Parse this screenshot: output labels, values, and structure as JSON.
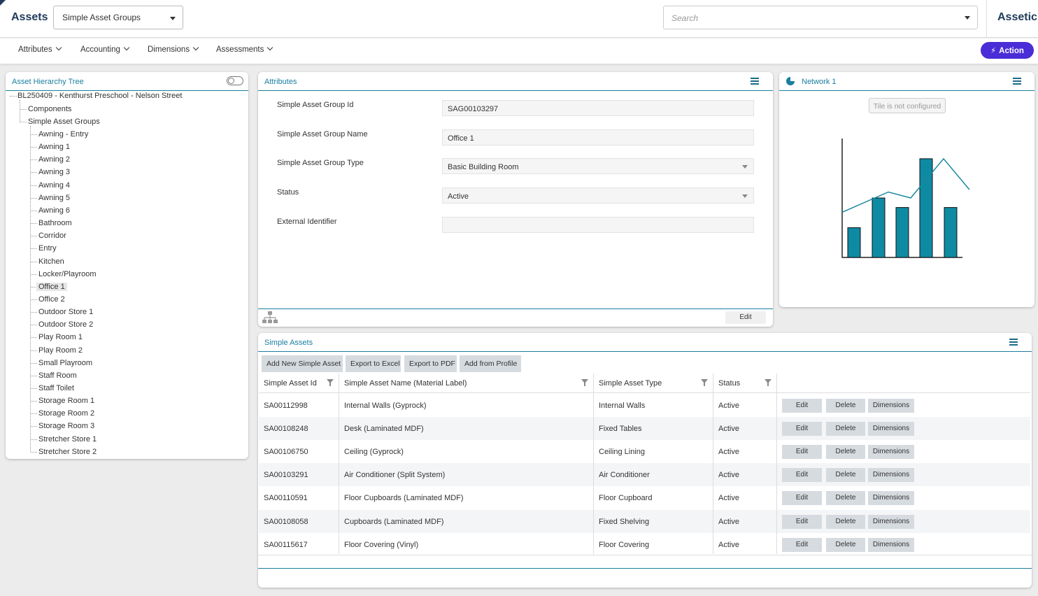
{
  "header": {
    "brand": "Assets",
    "group_select": "Simple Asset Groups",
    "search_placeholder": "Search",
    "logo": "Assetic"
  },
  "subnav": {
    "menus": [
      "Attributes",
      "Accounting",
      "Dimensions",
      "Assessments"
    ],
    "action_label": "Action"
  },
  "tree_panel": {
    "title": "Asset Hierarchy Tree",
    "root": "BL250409 - Kenthurst Preschool - Nelson Street",
    "components": "Components",
    "groups_label": "Simple Asset Groups",
    "selected": "Office 1",
    "items": [
      "Awning - Entry",
      "Awning 1",
      "Awning 2",
      "Awning 3",
      "Awning 4",
      "Awning 5",
      "Awning 6",
      "Bathroom",
      "Corridor",
      "Entry",
      "Kitchen",
      "Locker/Playroom",
      "Office 1",
      "Office 2",
      "Outdoor Store 1",
      "Outdoor Store 2",
      "Play Room 1",
      "Play Room 2",
      "Small Playroom",
      "Staff Room",
      "Staff Toilet",
      "Storage Room 1",
      "Storage Room 2",
      "Storage Room 3",
      "Stretcher Store 1",
      "Stretcher Store 2"
    ]
  },
  "attributes_panel": {
    "title": "Attributes",
    "fields": [
      {
        "label": "Simple Asset Group Id",
        "value": "SAG00103297"
      },
      {
        "label": "Simple Asset Group Name",
        "value": "Office 1"
      },
      {
        "label": "Simple Asset Group Type",
        "value": "Basic Building Room"
      },
      {
        "label": "Status",
        "value": "Active"
      },
      {
        "label": "External Identifier",
        "value": ""
      }
    ],
    "edit_label": "Edit"
  },
  "network_panel": {
    "title": "Network 1",
    "message": "Tile is not configured",
    "placeholder_chart": {
      "bars": [
        0.25,
        0.5,
        0.42,
        0.83,
        0.42
      ],
      "line": [
        0.38,
        0.55,
        0.5,
        0.83,
        0.57
      ],
      "bar_color": "#0f8aa3",
      "line_color": "#1a8aa0"
    }
  },
  "assets_panel": {
    "title": "Simple Assets",
    "toolbar": [
      "Add New Simple Asset",
      "Export to Excel",
      "Export to PDF",
      "Add from Profile"
    ],
    "columns": [
      "Simple Asset Id",
      "Simple Asset Name (Material Label)",
      "Simple Asset Type",
      "Status"
    ],
    "row_actions": [
      "Edit",
      "Delete",
      "Dimensions"
    ],
    "rows": [
      {
        "id": "SA00112998",
        "name": "Internal Walls (Gyprock)",
        "type": "Internal Walls",
        "status": "Active"
      },
      {
        "id": "SA00108248",
        "name": "Desk (Laminated MDF)",
        "type": "Fixed Tables",
        "status": "Active"
      },
      {
        "id": "SA00106750",
        "name": "Ceiling (Gyprock)",
        "type": "Ceiling Lining",
        "status": "Active"
      },
      {
        "id": "SA00103291",
        "name": "Air Conditioner (Split System)",
        "type": "Air Conditioner",
        "status": "Active"
      },
      {
        "id": "SA00110591",
        "name": "Floor Cupboards (Laminated MDF)",
        "type": "Floor Cupboard",
        "status": "Active"
      },
      {
        "id": "SA00108058",
        "name": "Cupboards (Laminated MDF)",
        "type": "Fixed Shelving",
        "status": "Active"
      },
      {
        "id": "SA00115617",
        "name": "Floor Covering (Vinyl)",
        "type": "Floor Covering",
        "status": "Active"
      }
    ]
  },
  "colors": {
    "brand": "#1f3a5a",
    "accent": "#1a7ea0",
    "action": "#4a2dd6"
  }
}
